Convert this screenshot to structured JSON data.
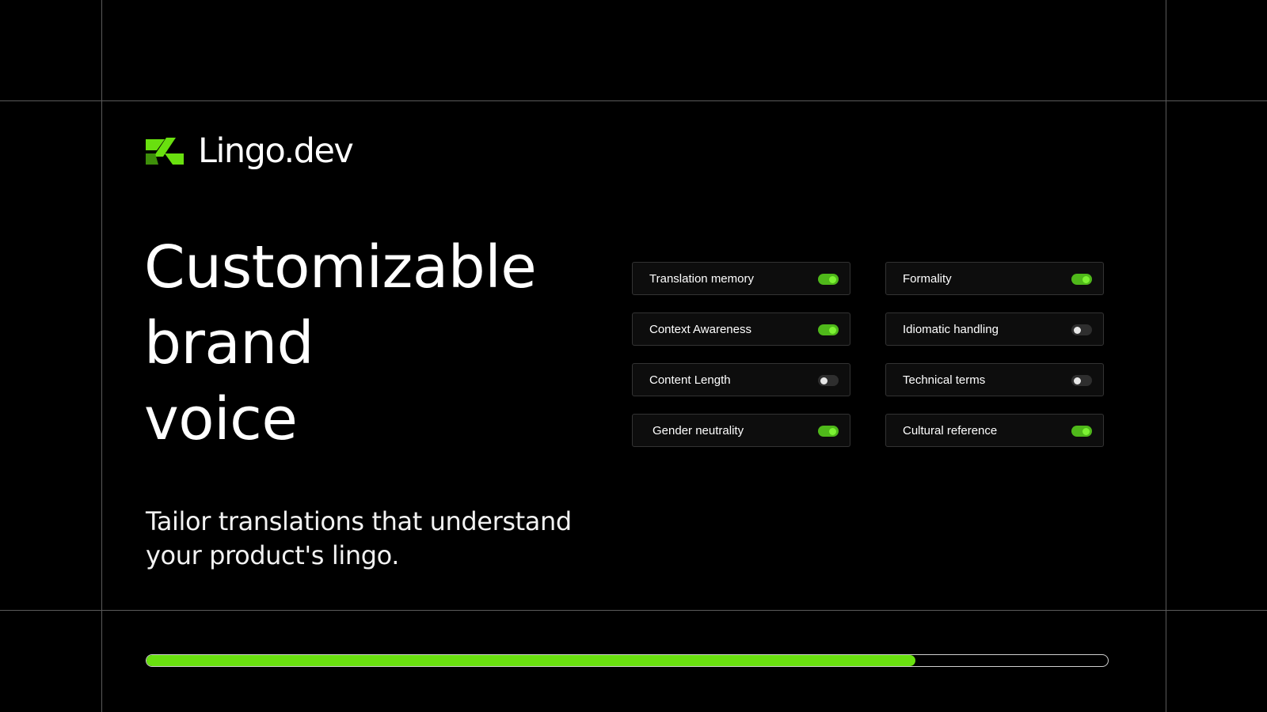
{
  "brand": {
    "name": "Lingo.dev",
    "accent_color": "#69e00f",
    "logo_icon": "lingo-logo-mark"
  },
  "headline": {
    "lines": [
      "Customizable",
      "brand",
      "voice"
    ]
  },
  "subtitle": {
    "lines": [
      "Tailor translations that understand",
      "your product's lingo."
    ]
  },
  "toggles": [
    {
      "label": "Translation memory",
      "enabled": true
    },
    {
      "label": "Formality",
      "enabled": true
    },
    {
      "label": "Context Awareness",
      "enabled": true
    },
    {
      "label": "Idiomatic handling",
      "enabled": false
    },
    {
      "label": "Content Length",
      "enabled": false
    },
    {
      "label": "Technical terms",
      "enabled": false
    },
    {
      "label": "Gender neutrality",
      "enabled": true
    },
    {
      "label": "Cultural reference",
      "enabled": true
    }
  ],
  "progress": {
    "fraction": 0.8
  },
  "colors": {
    "background": "#000000",
    "toggle_on": "#4fb81a",
    "toggle_off": "#2e2e2e"
  }
}
